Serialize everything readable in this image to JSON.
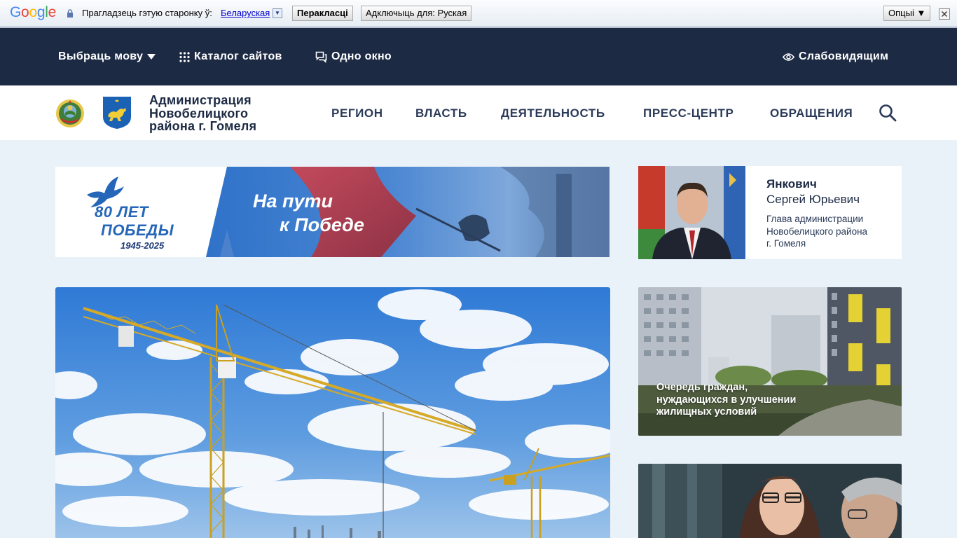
{
  "translate_bar": {
    "logo": "Google",
    "prompt": "Прагладзець гэтую старонку ў:",
    "language": "Беларуская",
    "translate_button": "Перакласці",
    "disable_button": "Адключыць для: Руская",
    "options_button": "Опцыі ▼"
  },
  "topnav": {
    "language": "Выбраць мову",
    "catalog": "Каталог сайтов",
    "one_window": "Одно окно",
    "low_vision": "Слабовидящим"
  },
  "header": {
    "title_line1": "Администрация",
    "title_line2": "Новобелицкого",
    "title_line3": "района г. Гомеля",
    "menu": [
      "РЕГИОН",
      "ВЛАСТЬ",
      "ДЕЯТЕЛЬНОСТЬ",
      "ПРЕСС-ЦЕНТР",
      "ОБРАЩЕНИЯ"
    ]
  },
  "banner": {
    "years_big": "80 ЛЕТ",
    "victory": "ПОБЕДЫ",
    "years_range": "1945-2025",
    "slogan_line1": "На пути",
    "slogan_line2": "к Победе"
  },
  "head": {
    "surname": "Янкович",
    "name": "Сергей Юрьевич",
    "position_line1": "Глава администрации",
    "position_line2": "Новобелицкого района",
    "position_line3": "г. Гомеля"
  },
  "queue_card": {
    "line1": "Очередь граждан,",
    "line2": "нуждающихся в улучшении",
    "line3": "жилищных условий"
  },
  "colors": {
    "nav_bg": "#1d2a44",
    "page_bg": "#e9f1f9",
    "accent_blue": "#2566b8"
  }
}
